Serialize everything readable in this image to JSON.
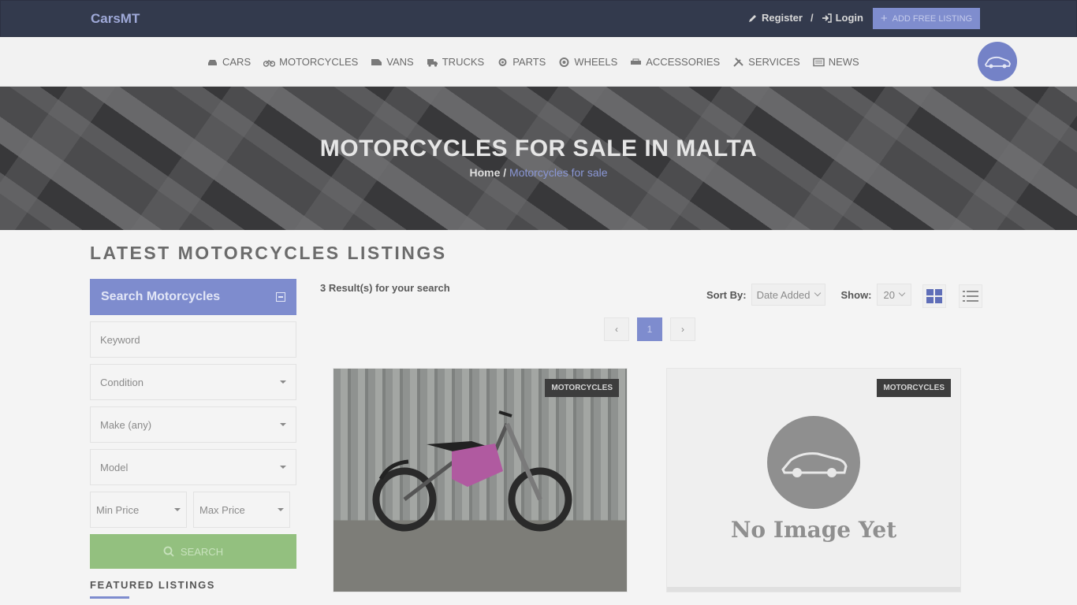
{
  "header": {
    "brand": "CarsMT",
    "register": "Register",
    "login": "Login",
    "separator": "/",
    "add_listing": "ADD FREE LISTING"
  },
  "nav": {
    "items": [
      {
        "label": "CARS",
        "icon": "car-icon"
      },
      {
        "label": "MOTORCYCLES",
        "icon": "motorcycle-icon"
      },
      {
        "label": "VANS",
        "icon": "van-icon"
      },
      {
        "label": "TRUCKS",
        "icon": "truck-icon"
      },
      {
        "label": "PARTS",
        "icon": "parts-icon"
      },
      {
        "label": "WHEELS",
        "icon": "wheel-icon"
      },
      {
        "label": "ACCESSORIES",
        "icon": "accessories-icon"
      },
      {
        "label": "SERVICES",
        "icon": "wrench-icon"
      },
      {
        "label": "NEWS",
        "icon": "news-icon"
      }
    ]
  },
  "hero": {
    "title": "MOTORCYCLES FOR SALE IN MALTA",
    "breadcrumb_home": "Home",
    "breadcrumb_sep": " / ",
    "breadcrumb_current": "Motorcycles for sale"
  },
  "main": {
    "section_title": "LATEST MOTORCYCLES LISTINGS",
    "results_text": "3 Result(s) for your search",
    "sort_label": "Sort By:",
    "sort_value": "Date Added",
    "show_label": "Show:",
    "show_value": "20",
    "pager": {
      "prev": "‹",
      "current": "1",
      "next": "›"
    }
  },
  "sidebar": {
    "title": "Search Motorcycles",
    "keyword_placeholder": "Keyword",
    "condition": "Condition",
    "make": "Make (any)",
    "model": "Model",
    "min_price": "Min Price",
    "max_price": "Max Price",
    "search_label": "SEARCH",
    "featured_title": "FEATURED LISTINGS"
  },
  "listings": [
    {
      "badge": "MOTORCYCLES",
      "has_image": true
    },
    {
      "badge": "MOTORCYCLES",
      "has_image": false,
      "no_image_text": "No Image Yet"
    }
  ],
  "colors": {
    "accent": "#7e8cce",
    "search_green": "#93c07f",
    "topbar": "#333a4d"
  }
}
